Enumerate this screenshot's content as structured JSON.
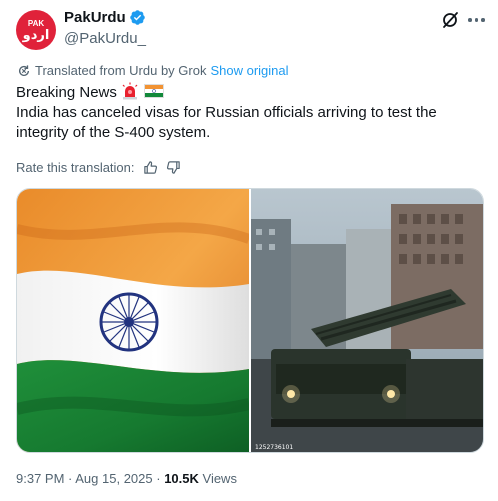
{
  "account": {
    "name": "PakUrdu",
    "handle": "@PakUrdu_",
    "avatar_text_top": "PAK",
    "avatar_text_bottom": "اردو",
    "avatar_color": "#e0223a",
    "verified_color": "#1d9bf0"
  },
  "icons": {
    "verified": "verified-badge-icon",
    "grok": "grok-icon",
    "more": "more-options-icon",
    "translate": "translate-icon",
    "thumbs_up": "thumbs-up-icon",
    "thumbs_down": "thumbs-down-icon",
    "siren": "siren-emoji-icon",
    "flag": "india-flag-emoji-icon"
  },
  "translation": {
    "label": "Translated from Urdu by Grok",
    "show_original": "Show original",
    "rate_label": "Rate this translation:"
  },
  "tweet": {
    "line1": "Breaking News",
    "line2": "India has canceled visas for Russian officials arriving to test the",
    "line3": "integrity of the S-400 system."
  },
  "media": {
    "image_caption": "1252736101"
  },
  "meta": {
    "time": "9:37 PM",
    "separator": " · ",
    "date": "Aug 15, 2025",
    "separator2": " · ",
    "views_count": "10.5K",
    "views_label": " Views"
  },
  "colors": {
    "link": "#1d9bf0",
    "secondary_text": "#536471",
    "primary_text": "#0f1419"
  }
}
